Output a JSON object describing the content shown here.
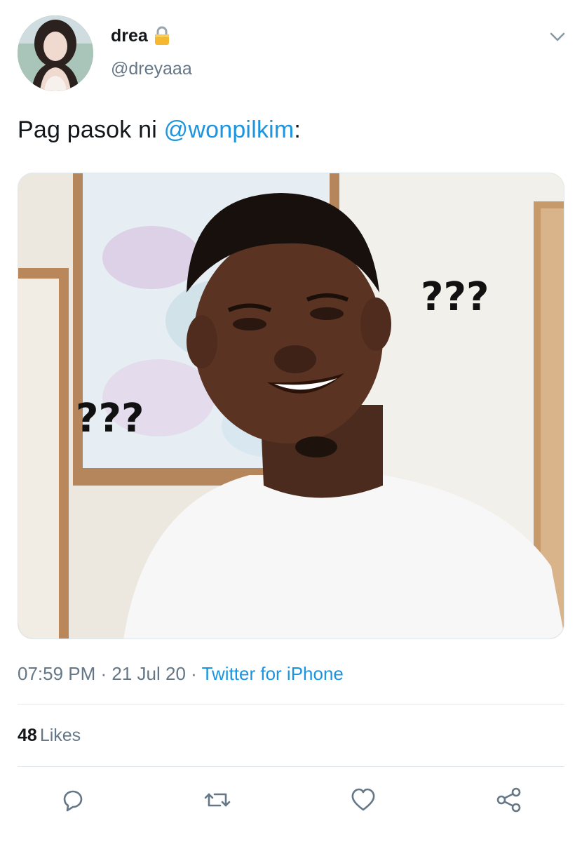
{
  "user": {
    "display_name": "drea",
    "handle": "@dreyaaa",
    "protected_icon": "lock-icon"
  },
  "tweet": {
    "text_before": "Pag pasok ni ",
    "mention": "@wonpilkim",
    "text_after": ":",
    "media": {
      "overlay_text_left": "???",
      "overlay_text_right": "???"
    }
  },
  "meta": {
    "time": "07:59 PM",
    "separator": " · ",
    "date": "21 Jul 20",
    "source": "Twitter for iPhone"
  },
  "stats": {
    "likes_count": "48",
    "likes_label": "Likes"
  },
  "actions": [
    "reply-icon",
    "retweet-icon",
    "like-icon",
    "share-icon"
  ],
  "colors": {
    "link": "#1b95e0",
    "secondary_text": "#657786",
    "primary_text": "#14171a",
    "divider": "#e1e8ed"
  }
}
